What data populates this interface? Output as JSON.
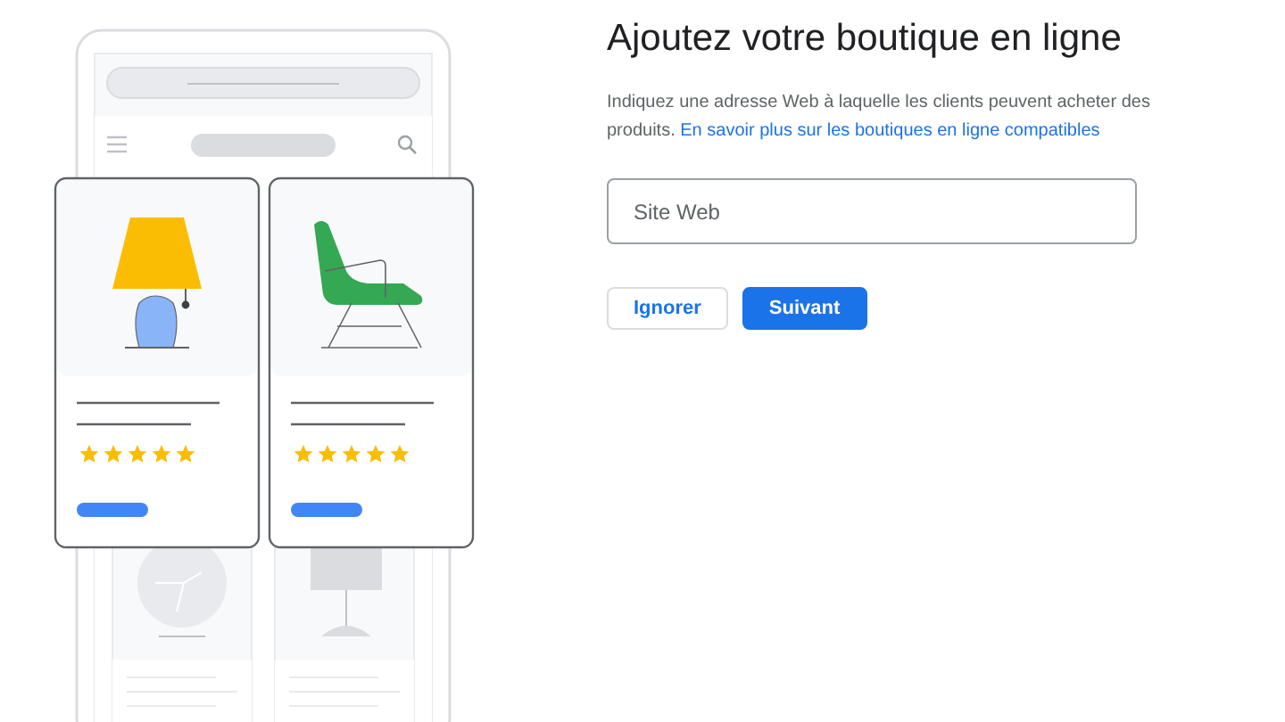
{
  "illustration": {
    "cards": [
      {
        "kind": "lamp",
        "stars": 5
      },
      {
        "kind": "chair",
        "stars": 5
      }
    ]
  },
  "title": "Ajoutez votre boutique en ligne",
  "description": {
    "text": "Indiquez une adresse Web à laquelle les clients peuvent acheter des produits.",
    "link": "En savoir plus sur les boutiques en ligne compatibles"
  },
  "website_field": {
    "placeholder": "Site Web"
  },
  "buttons": [
    {
      "label": "Ignorer",
      "kind": "outline"
    },
    {
      "label": "Suivant",
      "kind": "primary"
    }
  ]
}
